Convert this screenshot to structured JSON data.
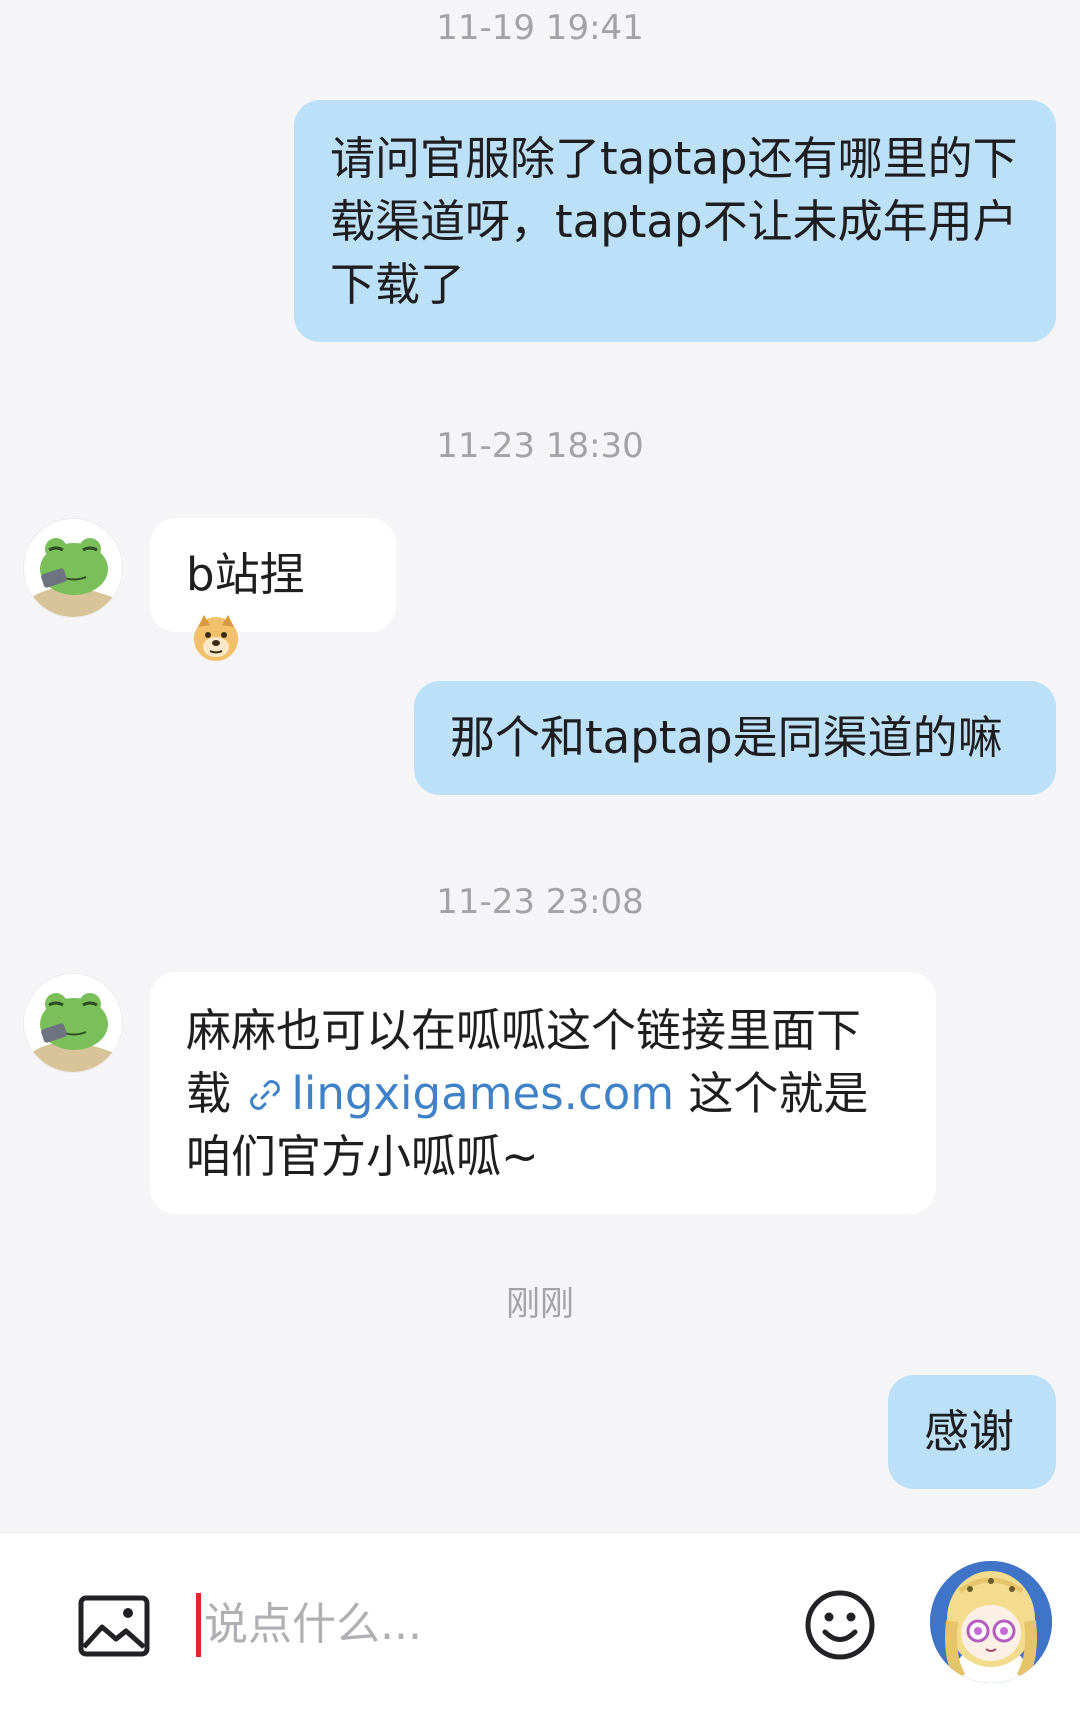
{
  "messages": [
    {
      "type": "timestamp",
      "text": "11-19 19:41"
    },
    {
      "type": "outgoing",
      "text": "请问官服除了taptap还有哪里的下载渠道呀，taptap不让未成年用户下载了"
    },
    {
      "type": "timestamp",
      "text": "11-23 18:30"
    },
    {
      "type": "incoming",
      "text": "b站捏",
      "emoji": "doge-emoji"
    },
    {
      "type": "outgoing",
      "text": "那个和taptap是同渠道的嘛"
    },
    {
      "type": "timestamp",
      "text": "11-23 23:08"
    },
    {
      "type": "incoming",
      "text_before": "麻麻也可以在呱呱这个链接里面下载",
      "link": "lingxigames.com",
      "text_after": "这个就是咱们官方小呱呱~"
    },
    {
      "type": "timestamp",
      "text": "刚刚"
    },
    {
      "type": "outgoing",
      "text": "感谢"
    }
  ],
  "input": {
    "placeholder": "说点什么..."
  },
  "icons": {
    "image": "image-icon",
    "emoji": "smiley-face-icon",
    "link": "link-icon",
    "contact_avatar": "frog-avatar",
    "user_avatar": "anime-girl-avatar"
  },
  "colors": {
    "outgoing_bubble": "#bce0f8",
    "incoming_bubble": "#ffffff",
    "background": "#f5f5f7",
    "link": "#3f82c8",
    "timestamp": "#a3a3a7",
    "caret": "#e0262e"
  }
}
